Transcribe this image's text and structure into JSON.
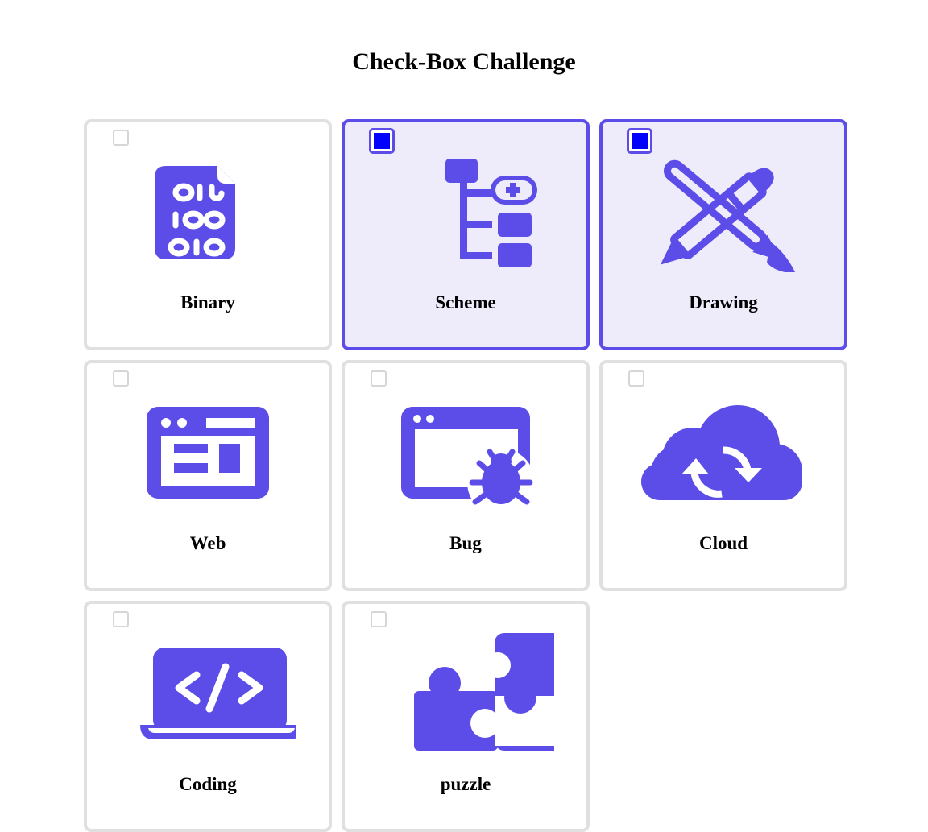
{
  "page": {
    "title": "Check-Box Challenge"
  },
  "accent_color": "#5c4de8",
  "checked_fill": "#0000ff",
  "cards": [
    {
      "label": "Binary",
      "icon": "binary-file-icon",
      "checked": false
    },
    {
      "label": "Scheme",
      "icon": "scheme-tree-icon",
      "checked": true
    },
    {
      "label": "Drawing",
      "icon": "pencil-brush-icon",
      "checked": true
    },
    {
      "label": "Web",
      "icon": "web-browser-icon",
      "checked": false
    },
    {
      "label": "Bug",
      "icon": "bug-window-icon",
      "checked": false
    },
    {
      "label": "Cloud",
      "icon": "cloud-sync-icon",
      "checked": false
    },
    {
      "label": "Coding",
      "icon": "laptop-code-icon",
      "checked": false
    },
    {
      "label": "puzzle",
      "icon": "puzzle-icon",
      "checked": false
    }
  ]
}
